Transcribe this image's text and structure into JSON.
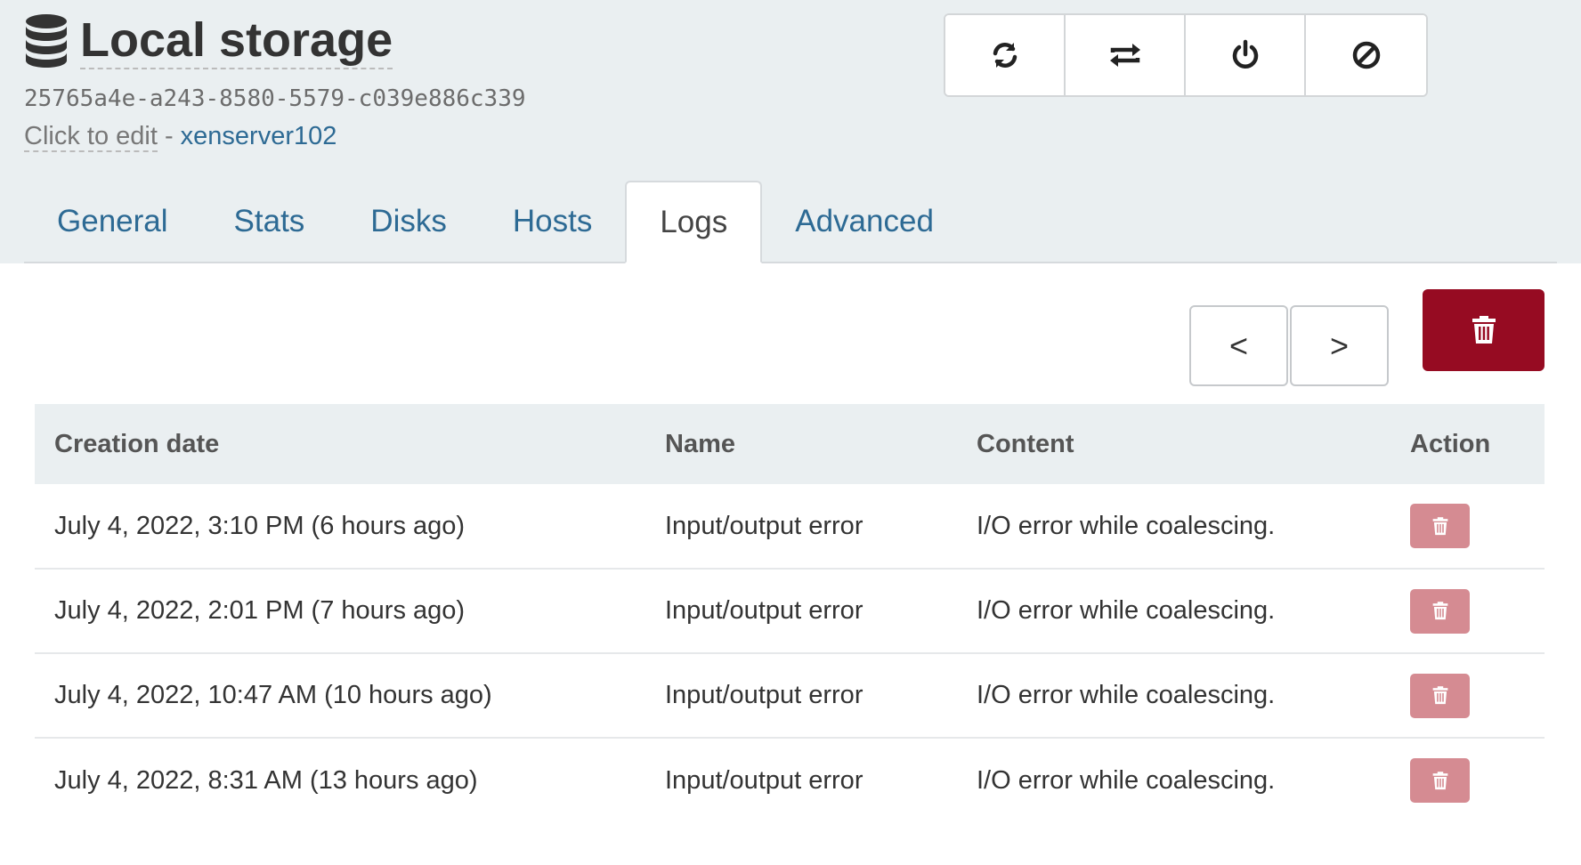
{
  "header": {
    "title": "Local storage",
    "uuid": "25765a4e-a243-8580-5579-c039e886c339",
    "edit_label": "Click to edit",
    "separator": " - ",
    "host": "xenserver102",
    "icon": "database-icon"
  },
  "toolbar": {
    "buttons": [
      {
        "icon": "refresh-icon"
      },
      {
        "icon": "rescan-icon"
      },
      {
        "icon": "power-icon"
      },
      {
        "icon": "forget-icon"
      }
    ]
  },
  "tabs": [
    {
      "label": "General"
    },
    {
      "label": "Stats"
    },
    {
      "label": "Disks"
    },
    {
      "label": "Hosts"
    },
    {
      "label": "Logs",
      "active": true
    },
    {
      "label": "Advanced"
    }
  ],
  "pager": {
    "prev": "<",
    "next": ">"
  },
  "colors": {
    "danger": "#960b22",
    "danger_light": "#d58b92",
    "link": "#2d6a94",
    "header_bg": "#eaeff1"
  },
  "logs": {
    "columns": [
      "Creation date",
      "Name",
      "Content",
      "Action"
    ],
    "rows": [
      {
        "date": "July 4, 2022, 3:10 PM (6 hours ago)",
        "name": "Input/output error",
        "content": "I/O error while coalescing."
      },
      {
        "date": "July 4, 2022, 2:01 PM (7 hours ago)",
        "name": "Input/output error",
        "content": "I/O error while coalescing."
      },
      {
        "date": "July 4, 2022, 10:47 AM (10 hours ago)",
        "name": "Input/output error",
        "content": "I/O error while coalescing."
      },
      {
        "date": "July 4, 2022, 8:31 AM (13 hours ago)",
        "name": "Input/output error",
        "content": "I/O error while coalescing."
      }
    ]
  }
}
